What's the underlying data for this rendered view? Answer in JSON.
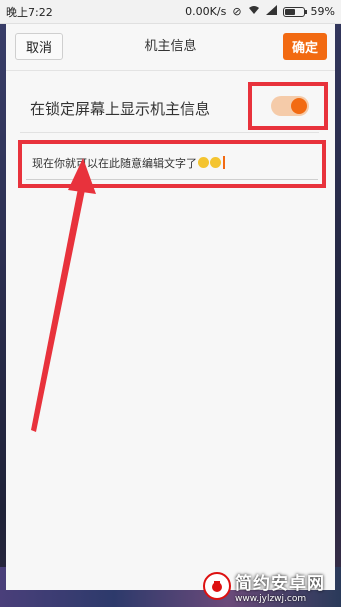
{
  "status": {
    "time": "晚上7:22",
    "speed": "0.00K/s",
    "battery": "59%",
    "battery_level": 0.59
  },
  "header": {
    "cancel_label": "取消",
    "title": "机主信息",
    "confirm_label": "确定"
  },
  "toggle_row": {
    "label": "在锁定屏幕上显示机主信息",
    "enabled": true
  },
  "edit_field": {
    "value": "现在你就可以在此随意编辑文字了"
  },
  "colors": {
    "accent": "#f26a12",
    "highlight": "#e8323c"
  },
  "watermark": {
    "title": "简约安卓网",
    "url": "www.jylzwj.com"
  }
}
